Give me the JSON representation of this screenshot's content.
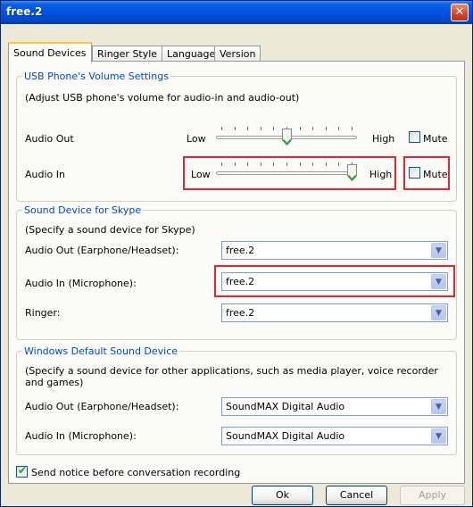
{
  "window": {
    "title": "free.2",
    "close_glyph": "✕"
  },
  "tabs": [
    {
      "label": "Sound Devices",
      "active": true
    },
    {
      "label": "Ringer Style",
      "active": false
    },
    {
      "label": "Language",
      "active": false
    },
    {
      "label": "Version",
      "active": false
    }
  ],
  "usb_volume": {
    "legend": "USB Phone's Volume Settings",
    "description": "(Adjust USB phone's volume for audio-in and audio-out)",
    "audio_out": {
      "label": "Audio Out",
      "low": "Low",
      "high": "High",
      "level": 0.5,
      "mute_label": "Mute",
      "muted": false
    },
    "audio_in": {
      "label": "Audio In",
      "low": "Low",
      "high": "High",
      "level": 1.0,
      "mute_label": "Mute",
      "muted": false
    }
  },
  "skype_device": {
    "legend": "Sound Device for Skype",
    "description": "(Specify a sound device for Skype)",
    "audio_out": {
      "label": "Audio Out (Earphone/Headset):",
      "value": "free.2"
    },
    "audio_in": {
      "label": "Audio In (Microphone):",
      "value": "free.2"
    },
    "ringer": {
      "label": "Ringer:",
      "value": "free.2"
    }
  },
  "windows_device": {
    "legend": "Windows Default Sound Device",
    "description": "(Specify a sound device for other applications, such as media player, voice recorder and games)",
    "audio_out": {
      "label": "Audio Out (Earphone/Headset):",
      "value": "SoundMAX Digital Audio"
    },
    "audio_in": {
      "label": "Audio In (Microphone):",
      "value": "SoundMAX Digital Audio"
    }
  },
  "notice": {
    "label": "Send notice before conversation recording",
    "checked": true
  },
  "buttons": {
    "ok": "Ok",
    "cancel": "Cancel",
    "apply": "Apply"
  },
  "colors": {
    "highlight": "#e8242e",
    "legend": "#0046d5",
    "titlebar": "#0054e3"
  }
}
